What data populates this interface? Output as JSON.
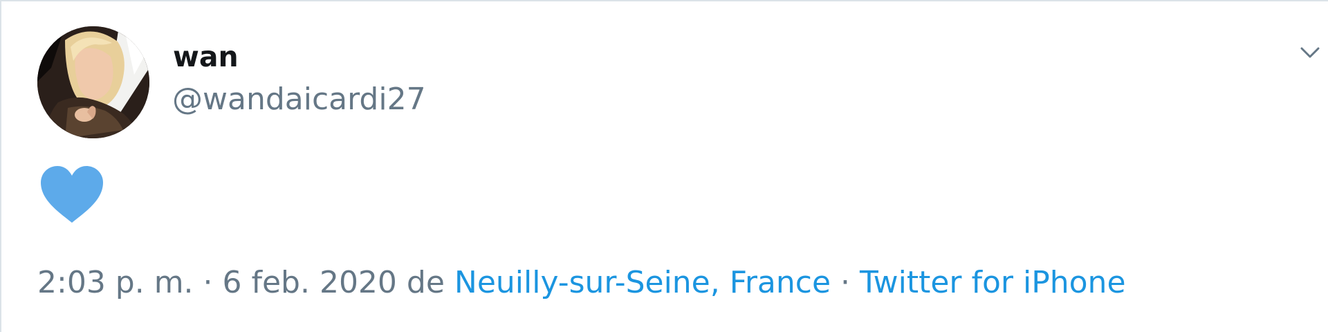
{
  "tweet": {
    "author": {
      "display_name": "wan",
      "handle": "@wandaicardi27"
    },
    "content": {
      "emoji_icon": "blue-heart-icon",
      "heart_color": "#5daaea"
    },
    "meta": {
      "timestamp": "2:03 p. m. · 6 feb. 2020",
      "from_word": "de",
      "location": "Neuilly-sur-Seine, France",
      "separator": "·",
      "client": "Twitter for iPhone"
    },
    "menu_icon": "chevron-down-icon"
  },
  "colors": {
    "link": "#1b95e0",
    "secondary_text": "#657786",
    "primary_text": "#14171a",
    "border": "#dbe3e8"
  }
}
